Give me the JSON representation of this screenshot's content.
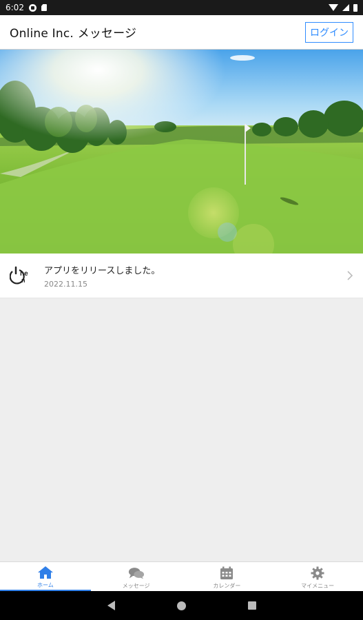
{
  "status_bar": {
    "time": "6:02",
    "icons": [
      "notification-icon",
      "sd-card-icon",
      "wifi-icon",
      "signal-icon",
      "battery-icon"
    ]
  },
  "header": {
    "title": "Online Inc. メッセージ",
    "login_label": "ログイン"
  },
  "hero": {
    "image": "golf-course-photo"
  },
  "news": {
    "items": [
      {
        "title": "アプリをリリースしました。",
        "date": "2022.11.15",
        "logo": "online-logo-icon"
      }
    ]
  },
  "bottom_nav": {
    "items": [
      {
        "label": "ホーム",
        "icon": "home-icon",
        "active": true
      },
      {
        "label": "メッセージ",
        "icon": "chat-icon",
        "active": false
      },
      {
        "label": "カレンダー",
        "icon": "calendar-icon",
        "active": false
      },
      {
        "label": "マイメニュー",
        "icon": "gear-icon",
        "active": false
      }
    ]
  },
  "colors": {
    "accent": "#2f7fe8",
    "login_border": "#2f8cff",
    "background": "#eeeeee"
  }
}
